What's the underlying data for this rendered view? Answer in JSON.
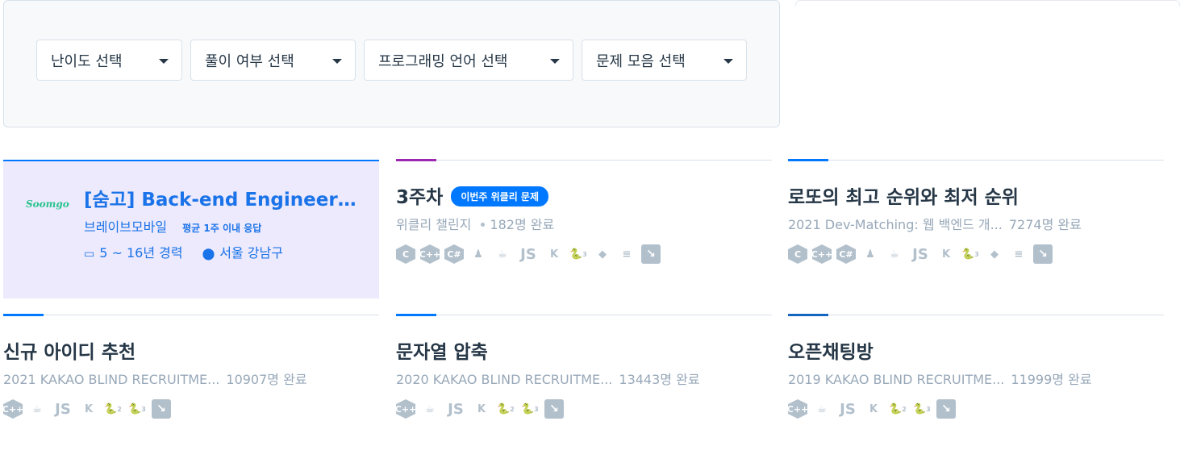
{
  "filters": [
    {
      "label": "난이도 선택"
    },
    {
      "label": "풀이 여부 선택"
    },
    {
      "label": "프로그래밍 언어 선택"
    },
    {
      "label": "문제 모음 선택"
    }
  ],
  "ad": {
    "logo": "Soomgo",
    "title": "[숨고] Back-end Engineer…",
    "company": "브레이브모바일",
    "response": "평균 1주 이내 응답",
    "experience": "5 ~ 16년 경력",
    "location": "서울 강남구"
  },
  "weekly_badge": "이번주 위클리 문제",
  "lang_icons": {
    "c": "C",
    "cpp": "C++",
    "csharp": "C#",
    "java": "☕",
    "js": "JS",
    "kotlin": "K",
    "py2": "2",
    "py3": "3",
    "ruby": "◆",
    "scala": "≡",
    "swift": "↘",
    "go": "♟"
  },
  "cards": [
    {
      "title": "3주차",
      "collection": "위클리 챌린지",
      "count": "182명 완료"
    },
    {
      "title": "로또의 최고 순위와 최저 순위",
      "collection": "2021 Dev-Matching: 웹 백엔드 개...",
      "count": "7274명 완료"
    },
    {
      "title": "신규 아이디 추천",
      "collection": "2021 KAKAO BLIND RECRUITME...",
      "count": "10907명 완료"
    },
    {
      "title": "문자열 압축",
      "collection": "2020 KAKAO BLIND RECRUITME...",
      "count": "13443명 완료"
    },
    {
      "title": "오픈채팅방",
      "collection": "2019 KAKAO BLIND RECRUITME...",
      "count": "11999명 완료"
    }
  ],
  "colors": {
    "accent_blue": "#0078ff",
    "accent_purple": "#9c27b0",
    "ad_background": "#edeafd",
    "icon_gray": "#b2c0cc"
  }
}
